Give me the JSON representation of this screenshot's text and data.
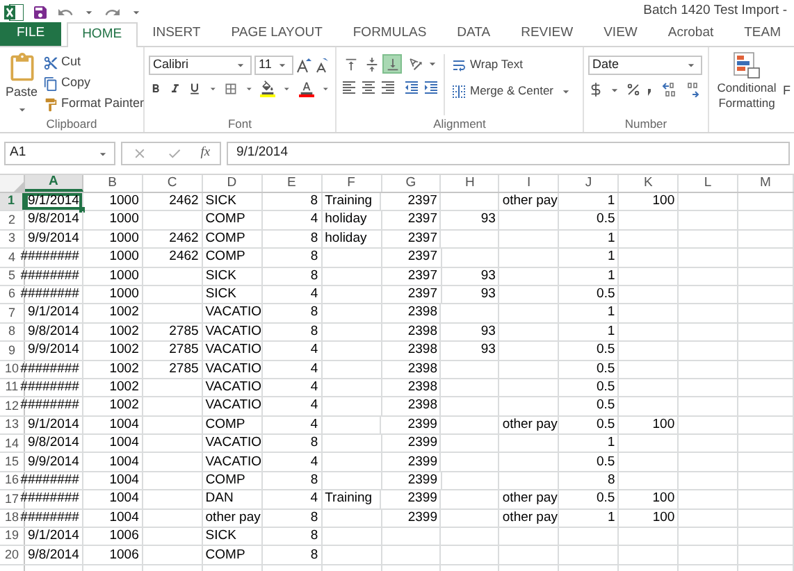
{
  "title_bar": {
    "title": "Batch 1420 Test Import -"
  },
  "tabs": [
    {
      "label": "FILE",
      "kind": "file",
      "selected": false
    },
    {
      "label": "HOME",
      "kind": "tab",
      "selected": true
    },
    {
      "label": "INSERT",
      "kind": "tab",
      "selected": false
    },
    {
      "label": "PAGE LAYOUT",
      "kind": "tab",
      "selected": false
    },
    {
      "label": "FORMULAS",
      "kind": "tab",
      "selected": false
    },
    {
      "label": "DATA",
      "kind": "tab",
      "selected": false
    },
    {
      "label": "REVIEW",
      "kind": "tab",
      "selected": false
    },
    {
      "label": "VIEW",
      "kind": "tab",
      "selected": false
    },
    {
      "label": "Acrobat",
      "kind": "tab",
      "selected": false
    },
    {
      "label": "TEAM",
      "kind": "tab",
      "selected": false
    }
  ],
  "ribbon": {
    "clipboard": {
      "label": "Clipboard",
      "paste": "Paste",
      "cut": "Cut",
      "copy": "Copy",
      "format_painter": "Format Painter"
    },
    "font": {
      "label": "Font",
      "family": "Calibri",
      "size": "11"
    },
    "alignment": {
      "label": "Alignment",
      "vertical": [
        {
          "selected": false
        },
        {
          "selected": false
        },
        {
          "selected": true
        }
      ],
      "wrap_text": "Wrap Text",
      "merge": "Merge & Center"
    },
    "number": {
      "label": "Number",
      "format": "Date"
    },
    "styles": {
      "conditional_formatting": "Conditional Formatting",
      "next": "F"
    }
  },
  "formula_bar": {
    "name_box": "A1",
    "function_label": "fx",
    "value": "9/1/2014"
  },
  "sheet": {
    "columns": [
      {
        "label": "A",
        "kind": "number",
        "selected": true
      },
      {
        "label": "B",
        "kind": "number",
        "selected": false
      },
      {
        "label": "C",
        "kind": "number",
        "selected": false
      },
      {
        "label": "D",
        "kind": "text",
        "selected": false
      },
      {
        "label": "E",
        "kind": "number",
        "selected": false
      },
      {
        "label": "F",
        "kind": "text",
        "selected": false
      },
      {
        "label": "G",
        "kind": "number",
        "selected": false
      },
      {
        "label": "H",
        "kind": "number",
        "selected": false
      },
      {
        "label": "I",
        "kind": "text",
        "selected": false
      },
      {
        "label": "J",
        "kind": "number",
        "selected": false
      },
      {
        "label": "K",
        "kind": "number",
        "selected": false
      },
      {
        "label": "L",
        "kind": "text",
        "selected": false
      },
      {
        "label": "M",
        "kind": "text",
        "selected": false
      }
    ],
    "rows": [
      {
        "header": "1",
        "selected": true,
        "cells": [
          "9/1/2014",
          "1000",
          "2462",
          "SICK",
          "8",
          "Training",
          "2397",
          null,
          "other pay",
          "1",
          "100"
        ]
      },
      {
        "header": "2",
        "selected": false,
        "cells": [
          "9/8/2014",
          "1000",
          null,
          "COMP",
          "4",
          "holiday",
          "2397",
          "93",
          null,
          "0.5",
          null
        ]
      },
      {
        "header": "3",
        "selected": false,
        "cells": [
          "9/9/2014",
          "1000",
          "2462",
          "COMP",
          "8",
          "holiday",
          "2397",
          null,
          null,
          "1",
          null
        ]
      },
      {
        "header": "4",
        "selected": false,
        "cells": [
          "########",
          "1000",
          "2462",
          "COMP",
          "8",
          null,
          "2397",
          null,
          null,
          "1",
          null
        ]
      },
      {
        "header": "5",
        "selected": false,
        "cells": [
          "########",
          "1000",
          null,
          "SICK",
          "8",
          null,
          "2397",
          "93",
          null,
          "1",
          null
        ]
      },
      {
        "header": "6",
        "selected": false,
        "cells": [
          "########",
          "1000",
          null,
          "SICK",
          "4",
          null,
          "2397",
          "93",
          null,
          "0.5",
          null
        ]
      },
      {
        "header": "7",
        "selected": false,
        "cells": [
          "9/1/2014",
          "1002",
          null,
          "VACATIO",
          "8",
          null,
          "2398",
          null,
          null,
          "1",
          null
        ]
      },
      {
        "header": "8",
        "selected": false,
        "cells": [
          "9/8/2014",
          "1002",
          "2785",
          "VACATIO",
          "8",
          null,
          "2398",
          "93",
          null,
          "1",
          null
        ]
      },
      {
        "header": "9",
        "selected": false,
        "cells": [
          "9/9/2014",
          "1002",
          "2785",
          "VACATIO",
          "4",
          null,
          "2398",
          "93",
          null,
          "0.5",
          null
        ]
      },
      {
        "header": "10",
        "selected": false,
        "cells": [
          "########",
          "1002",
          "2785",
          "VACATIO",
          "4",
          null,
          "2398",
          null,
          null,
          "0.5",
          null
        ]
      },
      {
        "header": "11",
        "selected": false,
        "cells": [
          "########",
          "1002",
          null,
          "VACATIO",
          "4",
          null,
          "2398",
          null,
          null,
          "0.5",
          null
        ]
      },
      {
        "header": "12",
        "selected": false,
        "cells": [
          "########",
          "1002",
          null,
          "VACATIO",
          "4",
          null,
          "2398",
          null,
          null,
          "0.5",
          null
        ]
      },
      {
        "header": "13",
        "selected": false,
        "cells": [
          "9/1/2014",
          "1004",
          null,
          "COMP",
          "4",
          null,
          "2399",
          null,
          "other pay",
          "0.5",
          "100"
        ]
      },
      {
        "header": "14",
        "selected": false,
        "cells": [
          "9/8/2014",
          "1004",
          null,
          "VACATIO",
          "8",
          null,
          "2399",
          null,
          null,
          "1",
          null
        ]
      },
      {
        "header": "15",
        "selected": false,
        "cells": [
          "9/9/2014",
          "1004",
          null,
          "VACATIO",
          "4",
          null,
          "2399",
          null,
          null,
          "0.5",
          null
        ]
      },
      {
        "header": "16",
        "selected": false,
        "cells": [
          "########",
          "1004",
          null,
          "COMP",
          "8",
          null,
          "2399",
          null,
          null,
          "8",
          null
        ]
      },
      {
        "header": "17",
        "selected": false,
        "cells": [
          "########",
          "1004",
          null,
          "DAN",
          "4",
          "Training",
          "2399",
          null,
          "other pay",
          "0.5",
          "100"
        ]
      },
      {
        "header": "18",
        "selected": false,
        "cells": [
          "########",
          "1004",
          null,
          "other pay",
          "8",
          null,
          "2399",
          null,
          "other pay",
          "1",
          "100"
        ]
      },
      {
        "header": "19",
        "selected": false,
        "cells": [
          "9/1/2014",
          "1006",
          null,
          "SICK",
          "8",
          null,
          null,
          null,
          null,
          null,
          null
        ]
      },
      {
        "header": "20",
        "selected": false,
        "cells": [
          "9/8/2014",
          "1006",
          null,
          "COMP",
          "8",
          null,
          null,
          null,
          null,
          null,
          null
        ]
      }
    ]
  }
}
